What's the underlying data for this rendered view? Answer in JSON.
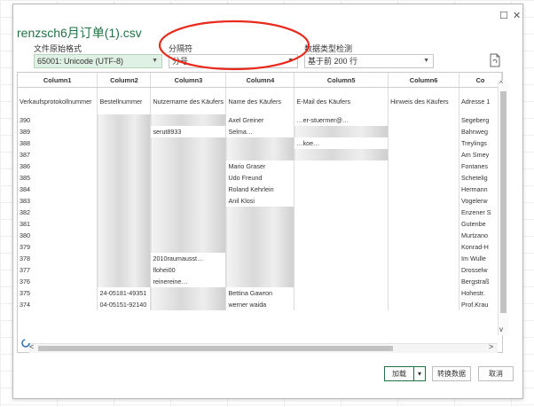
{
  "window": {
    "title": "renzsch6月订单(1).csv",
    "restore_glyph": "☐",
    "close_glyph": "✕"
  },
  "settings": {
    "file_origin": {
      "label": "文件原始格式",
      "value": "65001: Unicode (UTF-8)"
    },
    "delimiter": {
      "label": "分隔符",
      "value": "分号"
    },
    "type_detection": {
      "label": "数据类型检测",
      "value": "基于前 200 行"
    }
  },
  "table": {
    "columns": [
      "Column1",
      "Column2",
      "Column3",
      "Column4",
      "Column5",
      "Column6",
      "Co"
    ],
    "header_row": [
      "Verkaufsprotokollnummer",
      "Bestellnummer",
      "Nutzername des Käufers",
      "Name des Käufers",
      "E-Mail des Käufers",
      "Hinweis des Käufers",
      "Adresse 1"
    ],
    "rows": [
      [
        "390",
        "12-05279-1…27",
        "derkelte66",
        "Axel Greiner",
        "…er-stuermer@…",
        "",
        "Segeberg"
      ],
      [
        "389",
        "03-05279-…",
        "serut8933",
        "Selma…",
        "…ralera1976…",
        "",
        "Bahnweg"
      ],
      [
        "388",
        "12-0526…0",
        "vivi…2",
        "…cher",
        "…koe…",
        "",
        "Treylings"
      ],
      [
        "387",
        "09-0526…26",
        "…dmwotf",
        "…a Becker",
        "…yaho…",
        "",
        "Am Smey"
      ],
      [
        "386",
        "26-05…",
        "",
        "Mario Graser",
        "",
        "",
        "Fontanes"
      ],
      [
        "385",
        "02-0…",
        "…unm…",
        "Udo Freund",
        "",
        "",
        "Schetelig"
      ],
      [
        "384",
        "18-…",
        "rolkel…",
        "Roland Kehrlein",
        "",
        "",
        "Hermann"
      ],
      [
        "383",
        "21-…29",
        "bush…",
        "Anil Klosi",
        "",
        "",
        "Vogelerw"
      ],
      [
        "382",
        "1…728",
        "tach…mitz",
        "…Esser",
        "",
        "",
        "Enzener S"
      ],
      [
        "381",
        "1…04242",
        "gr…1255",
        "…yna Taraszkiewicz",
        "",
        "",
        "Gutenbe"
      ],
      [
        "380",
        "1…5-",
        "m…o",
        "…e Me…",
        "",
        "",
        "Murtzano"
      ],
      [
        "379",
        "09-0520…",
        "he…pc",
        "…he…",
        "",
        "",
        "Konrad-H"
      ],
      [
        "378",
        "02-05…25",
        "2010raumausst…",
        "…",
        "",
        "",
        "Im Wulle"
      ],
      [
        "377",
        "16-0…6326",
        "flohei00",
        "…er",
        "",
        "",
        "Drosselw"
      ],
      [
        "376",
        "26-0…78888",
        "reinereine…",
        "…8",
        "",
        "",
        "Bergstraß"
      ],
      [
        "375",
        "24-05181-49351",
        "fineart_j…wesel",
        "Bettina Gawron",
        "",
        "",
        "Hohestr."
      ],
      [
        "374",
        "04-05151-92140",
        "werner30…",
        "werner waida",
        "",
        "",
        "Prof.Krau"
      ]
    ]
  },
  "buttons": {
    "load": "加载",
    "load_menu_glyph": "▾",
    "transform": "转换数据",
    "cancel": "取消"
  },
  "scroll": {
    "up": "^",
    "down": "v",
    "left": "<",
    "right": ">"
  },
  "colors": {
    "accent": "#217346",
    "annotation": "#e8291c"
  }
}
